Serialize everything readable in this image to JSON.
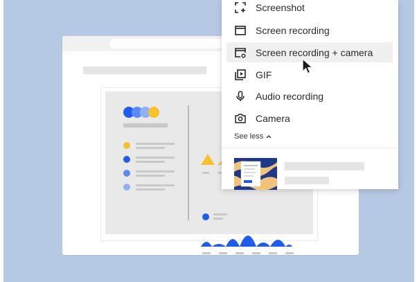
{
  "menu": {
    "items": [
      {
        "label": "Screenshot",
        "icon": "screenshot-icon"
      },
      {
        "label": "Screen recording",
        "icon": "screen-recording-icon"
      },
      {
        "label": "Screen recording + camera",
        "icon": "screen-camera-icon"
      },
      {
        "label": "GIF",
        "icon": "gif-icon"
      },
      {
        "label": "Audio recording",
        "icon": "microphone-icon"
      },
      {
        "label": "Camera",
        "icon": "camera-icon"
      }
    ],
    "see_less_label": "See less",
    "hovered_item": "Screen recording + camera"
  },
  "colors": {
    "background": "#b6c9e4",
    "accent_blue": "#1e5cf0",
    "accent_yellow": "#f6c22b",
    "menu_hover": "#f0f0f0"
  }
}
